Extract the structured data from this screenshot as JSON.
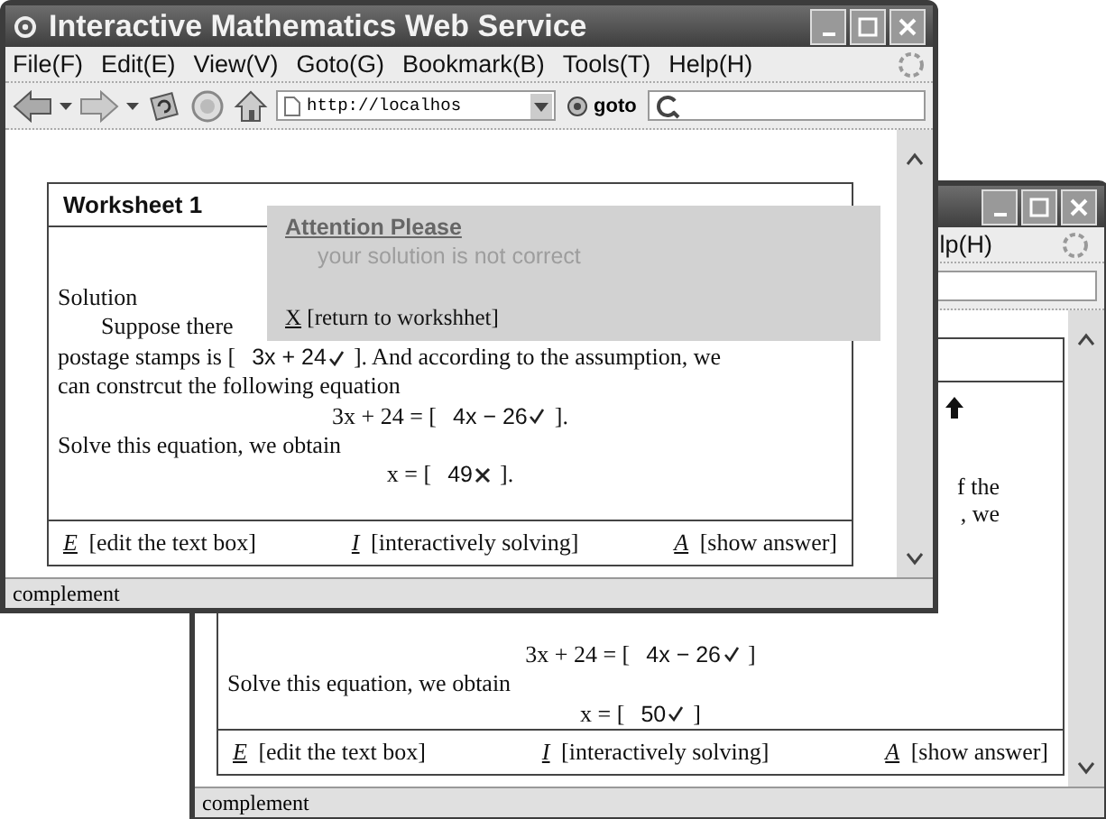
{
  "back_window": {
    "menu": [
      {
        "label": "lp(H)"
      }
    ],
    "fragments": [
      "f the",
      ", we"
    ],
    "lines": [
      {
        "kind": "center",
        "text": "3x + 24 = [",
        "answer": {
          "value": "4x − 26",
          "correct": true
        },
        "after": "]"
      },
      {
        "kind": "left",
        "text": "Solve this equation, we obtain"
      },
      {
        "kind": "center",
        "text": "x = [",
        "answer": {
          "value": "50",
          "correct": true
        },
        "after": "]"
      }
    ],
    "actions": [
      {
        "key": "E",
        "label": "[edit the text box]"
      },
      {
        "key": "I",
        "label": "[interactively solving]"
      },
      {
        "key": "A",
        "label": "[show answer]"
      }
    ],
    "status": "complement"
  },
  "front_window": {
    "title": "Interactive Mathematics Web Service",
    "menu": [
      {
        "label": "File(F)"
      },
      {
        "label": "Edit(E)"
      },
      {
        "label": "View(V)"
      },
      {
        "label": "Goto(G)"
      },
      {
        "label": "Bookmark(B)"
      },
      {
        "label": "Tools(T)"
      },
      {
        "label": "Help(H)"
      }
    ],
    "address": "http://localhos",
    "go_label": "goto",
    "worksheet": {
      "title": "Worksheet 1",
      "lines": [
        {
          "kind": "left",
          "text": "Solution"
        },
        {
          "kind": "indent",
          "text": "Suppose there"
        },
        {
          "kind": "left",
          "text": "postage stamps is [",
          "answer": {
            "value": "3x + 24",
            "correct": true
          },
          "after": "]. And according to the assumption, we"
        },
        {
          "kind": "left",
          "text": "can constrcut the following equation"
        },
        {
          "kind": "center",
          "text": "3x + 24 = [",
          "answer": {
            "value": "4x − 26",
            "correct": true
          },
          "after": "]."
        },
        {
          "kind": "left",
          "text": "Solve this equation, we obtain"
        },
        {
          "kind": "center",
          "text": "x = [",
          "answer": {
            "value": "49",
            "correct": false
          },
          "after": "]."
        }
      ],
      "actions": [
        {
          "key": "E",
          "label": "[edit the text box]"
        },
        {
          "key": "I",
          "label": "[interactively solving]"
        },
        {
          "key": "A",
          "label": "[show answer]"
        }
      ]
    },
    "alert": {
      "title": "Attention Please",
      "message": "your solution is not correct",
      "close_key": "X",
      "close_label": "[return to workshhet]"
    },
    "status": "complement"
  }
}
